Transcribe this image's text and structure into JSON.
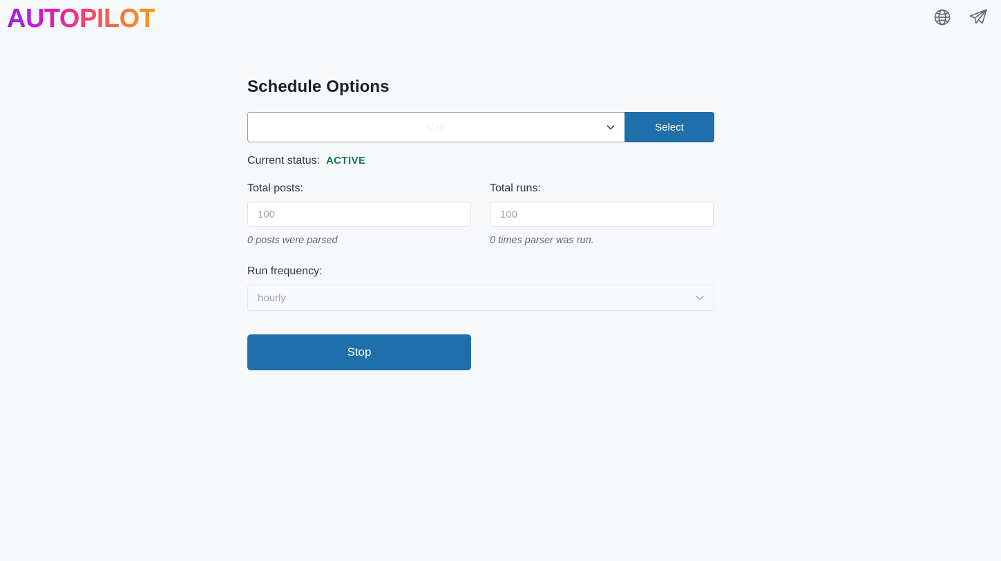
{
  "header": {
    "logo_text": "AUTOPILOT",
    "icons": [
      {
        "name": "globe-icon",
        "title": "Language"
      },
      {
        "name": "telegram-icon",
        "title": "Telegram"
      }
    ]
  },
  "main": {
    "title": "Schedule Options",
    "source_select": {
      "value": "s/all/",
      "button_label": "Select"
    },
    "status": {
      "label": "Current status:",
      "value": "ACTIVE",
      "color": "#0e7a54"
    },
    "total_posts": {
      "label": "Total posts:",
      "value": "",
      "placeholder": "100",
      "hint": "0 posts were parsed"
    },
    "total_runs": {
      "label": "Total runs:",
      "value": "",
      "placeholder": "100",
      "hint": "0 times parser was run."
    },
    "run_frequency": {
      "label": "Run frequency:",
      "value": "hourly"
    },
    "primary_action": {
      "label": "Stop",
      "color": "#1f6fab"
    }
  }
}
